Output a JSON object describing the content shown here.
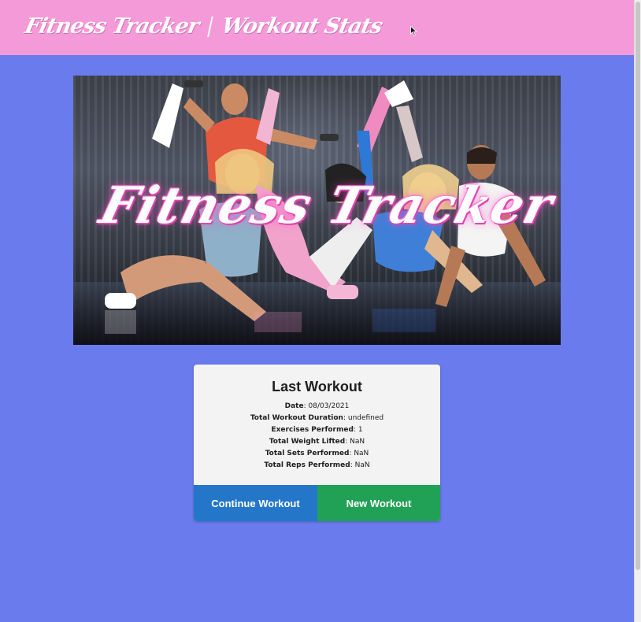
{
  "navbar": {
    "brand": "Fitness Tracker",
    "stats_link": "Workout Stats"
  },
  "hero": {
    "logo_text": "Fitness Tracker"
  },
  "last_workout": {
    "title": "Last Workout",
    "stats": [
      {
        "label": "Date",
        "value": "08/03/2021"
      },
      {
        "label": "Total Workout Duration",
        "value": "undefined"
      },
      {
        "label": "Exercises Performed",
        "value": "1"
      },
      {
        "label": "Total Weight Lifted",
        "value": "NaN"
      },
      {
        "label": "Total Sets Performed",
        "value": "NaN"
      },
      {
        "label": "Total Reps Performed",
        "value": "NaN"
      }
    ],
    "continue_button": "Continue Workout",
    "new_button": "New Workout"
  },
  "colors": {
    "page_background": "#6a7bed",
    "navbar": "#f59ad9",
    "continue_button": "#2477c8",
    "new_button": "#21a155"
  }
}
